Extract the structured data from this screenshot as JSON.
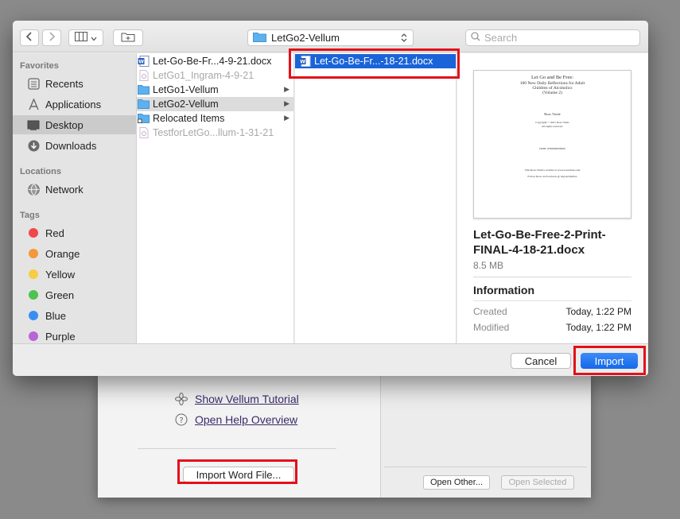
{
  "dialog": {
    "toolbar": {
      "back_icon": "chevron-left-icon",
      "forward_icon": "chevron-right-icon",
      "view_icon": "column-view-icon",
      "new_folder_icon": "new-folder-icon",
      "path_label": "LetGo2-Vellum",
      "search_placeholder": "Search"
    },
    "sidebar": {
      "favorites_heading": "Favorites",
      "favorites": [
        {
          "label": "Recents",
          "icon": "recents-icon"
        },
        {
          "label": "Applications",
          "icon": "applications-icon"
        },
        {
          "label": "Desktop",
          "icon": "desktop-icon",
          "selected": true
        },
        {
          "label": "Downloads",
          "icon": "downloads-icon"
        }
      ],
      "locations_heading": "Locations",
      "locations": [
        {
          "label": "Network",
          "icon": "network-icon"
        }
      ],
      "tags_heading": "Tags",
      "tags": [
        {
          "label": "Red",
          "color": "#f0484a"
        },
        {
          "label": "Orange",
          "color": "#f4983a"
        },
        {
          "label": "Yellow",
          "color": "#f6cd45"
        },
        {
          "label": "Green",
          "color": "#4fc24f"
        },
        {
          "label": "Blue",
          "color": "#3a8ef2"
        },
        {
          "label": "Purple",
          "color": "#b865d6"
        }
      ]
    },
    "column1": [
      {
        "label": "Let-Go-Be-Fr...4-9-21.docx",
        "kind": "word-doc-icon",
        "dim": false
      },
      {
        "label": "LetGo1_Ingram-4-9-21",
        "kind": "document-icon",
        "dim": true
      },
      {
        "label": "LetGo1-Vellum",
        "kind": "folder-icon",
        "dim": false,
        "chevron": true
      },
      {
        "label": "LetGo2-Vellum",
        "kind": "folder-icon",
        "dim": false,
        "chevron": true,
        "selected": true
      },
      {
        "label": "Relocated Items",
        "kind": "folder-icon",
        "dim": false,
        "chevron": true
      },
      {
        "label": "TestforLetGo...llum-1-31-21",
        "kind": "document-icon",
        "dim": true
      }
    ],
    "column2": [
      {
        "label": "Let-Go-Be-Fr...-18-21.docx",
        "kind": "word-doc-icon",
        "selected": true
      }
    ],
    "preview": {
      "thumbnail_lines": {
        "l1": "Let Go and Be Free:",
        "l2": "100 New Daily Reflections for Adult",
        "l3": "Children of Alcoholics",
        "l4": "(Volume 2)",
        "l5": "Ross Vitale",
        "l6": "Copyright © 2021 Ross Vitale",
        "l7": "All rights reserved.",
        "l8": "ISBN: 9798000000000",
        "l9": "Visit Ross Vitale's website at www.rossvitale.com",
        "l10": "Follow Ross on Facebook @ letgoandbefree"
      },
      "file_name": "Let-Go-Be-Free-2-Print-FINAL-4-18-21.docx",
      "file_size": "8.5 MB",
      "info_heading": "Information",
      "created_label": "Created",
      "created_value": "Today, 1:22 PM",
      "modified_label": "Modified",
      "modified_value": "Today, 1:22 PM"
    },
    "footer": {
      "cancel_label": "Cancel",
      "import_label": "Import"
    }
  },
  "background_window": {
    "tutorial_link": "Show Vellum Tutorial",
    "help_link": "Open Help Overview",
    "import_word_label": "Import Word File...",
    "open_other_label": "Open Other...",
    "open_selected_label": "Open Selected"
  },
  "colors": {
    "selection_blue": "#1a63d8",
    "highlight_red": "#e3101a"
  }
}
